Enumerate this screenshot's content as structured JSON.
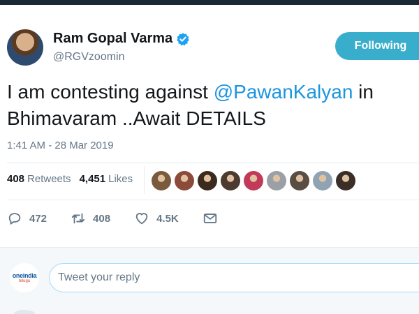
{
  "author": {
    "display_name": "Ram Gopal Varma",
    "handle": "@RGVzoomin",
    "verified": true,
    "avatar_icon": "profile-photo"
  },
  "follow_button": {
    "label": "Following",
    "color": "#38aecc"
  },
  "tweet": {
    "text_before": "I am contesting against ",
    "mention": "@PawanKalyan",
    "text_after": " in Bhimavaram  ..Await DETAILS",
    "timestamp": "1:41 AM - 28 Mar 2019"
  },
  "stats": {
    "retweets_count": "408",
    "retweets_label": "Retweets",
    "likes_count": "4,451",
    "likes_label": "Likes"
  },
  "likers": [
    {
      "color": "#7a5a3c"
    },
    {
      "color": "#8b4a3a"
    },
    {
      "color": "#3b2a1e"
    },
    {
      "color": "#4a3a30"
    },
    {
      "color": "#c23a5a"
    },
    {
      "color": "#9aa0a6"
    },
    {
      "color": "#5a4e44"
    },
    {
      "color": "#8fa3b3"
    },
    {
      "color": "#3a2e26"
    }
  ],
  "actions": {
    "reply": {
      "icon": "reply-icon",
      "count": "472"
    },
    "retweet": {
      "icon": "retweet-icon",
      "count": "408"
    },
    "like": {
      "icon": "heart-icon",
      "count": "4.5K"
    },
    "dm": {
      "icon": "envelope-icon"
    }
  },
  "reply_box": {
    "placeholder": "Tweet your reply",
    "brand_main": "oneindia",
    "brand_sub": "telugu"
  },
  "colors": {
    "accent": "#1b95e0",
    "muted": "#657786",
    "text": "#14171a"
  }
}
